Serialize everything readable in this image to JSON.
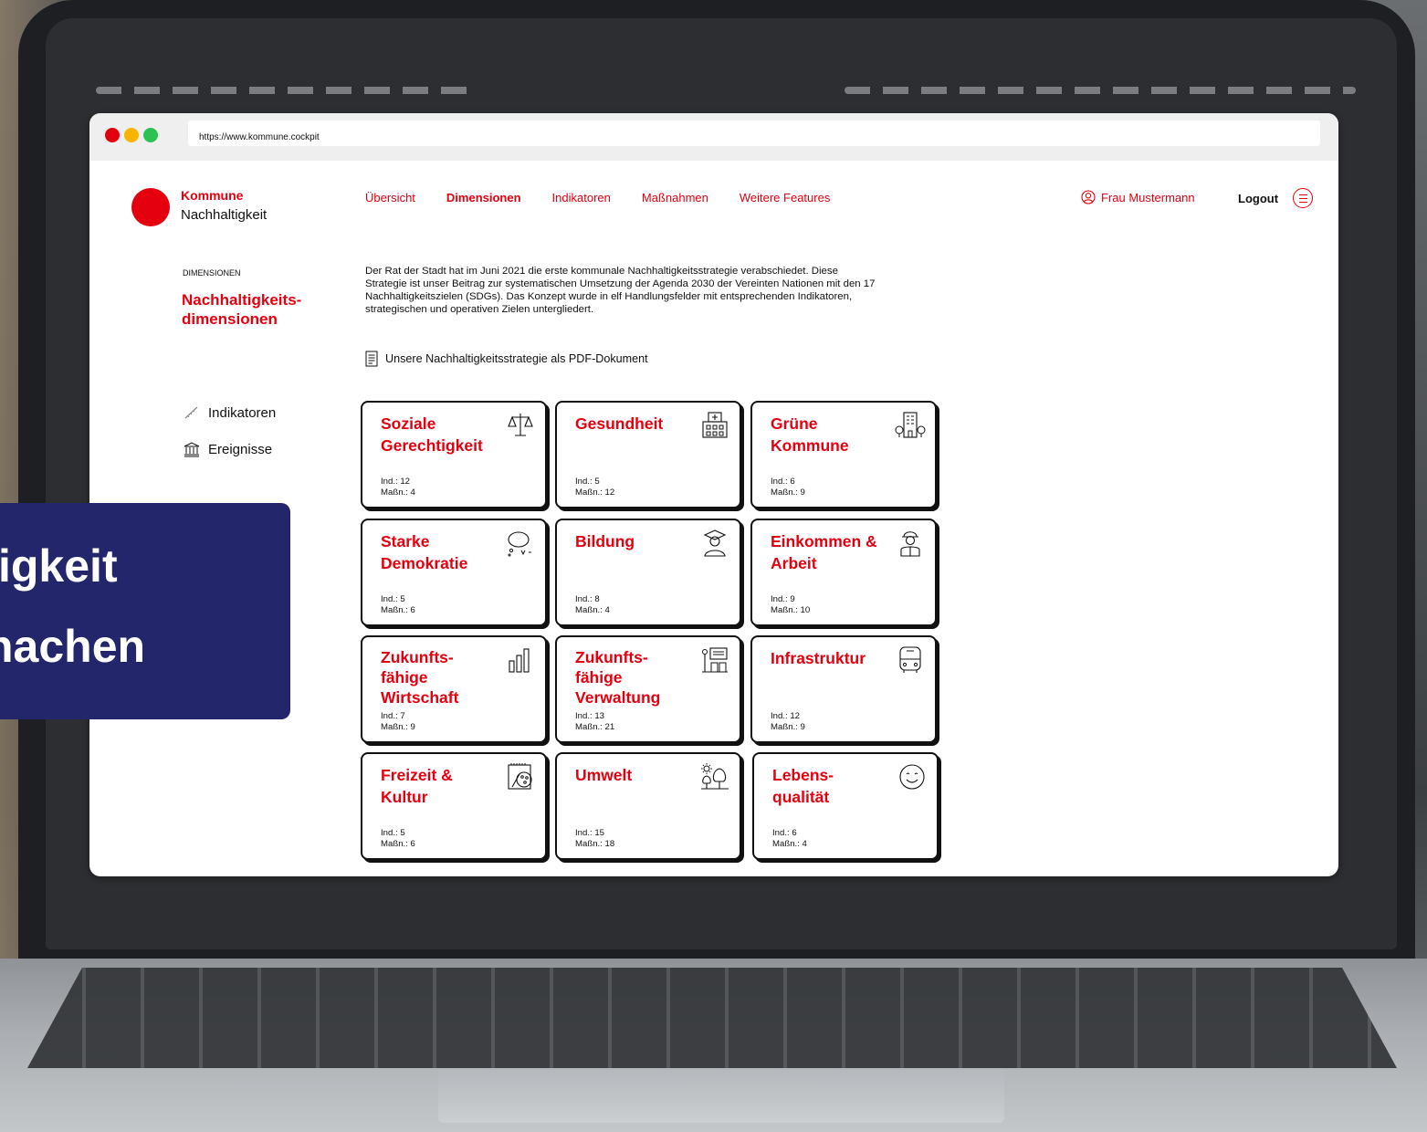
{
  "browser": {
    "url": "https://www.kommune.cockpit"
  },
  "brand": {
    "line1": "Kommune",
    "line2": "Nachhaltigkeit"
  },
  "nav": {
    "items": [
      {
        "label": "Übersicht",
        "active": false
      },
      {
        "label": "Dimensionen",
        "active": true
      },
      {
        "label": "Indikatoren",
        "active": false
      },
      {
        "label": "Maßnahmen",
        "active": false
      },
      {
        "label": "Weitere Features",
        "active": false
      }
    ]
  },
  "user": {
    "name": "Frau Mustermann",
    "logout_label": "Logout"
  },
  "sidebar": {
    "section_label": "DIMENSIONEN",
    "title": "Nachhaltigkeits-dimensionen",
    "links": [
      {
        "label": "Indikatoren",
        "icon": "ruler-icon"
      },
      {
        "label": "Ereignisse",
        "icon": "museum-icon"
      }
    ]
  },
  "intro": {
    "text": "Der Rat der Stadt hat im Juni 2021 die erste kommunale Nachhaltigkeitsstrategie verabschiedet. Diese Strategie ist unser Beitrag zur systematischen Umsetzung der Agenda 2030 der Vereinten Nationen mit den 17 Nachhaltigkeitszielen (SDGs). Das Konzept wurde in elf Handlungsfelder mit entsprechenden Indikatoren, strategischen und operativen Zielen untergliedert.",
    "pdf_link": "Unsere Nachhaltigkeitsstrategie als PDF-Dokument"
  },
  "cards": [
    {
      "title": "Soziale Gerechtigkeit",
      "ind": "Ind.: 12",
      "mass": "Maßn.: 4",
      "icon": "scales-icon"
    },
    {
      "title": "Gesundheit",
      "ind": "Ind.: 5",
      "mass": "Maßn.: 12",
      "icon": "hospital-icon"
    },
    {
      "title": "Grüne Kommune",
      "ind": "Ind.: 6",
      "mass": "Maßn.: 9",
      "icon": "green-building-icon"
    },
    {
      "title": "Starke Demokratie",
      "ind": "Ind.: 5",
      "mass": "Maßn.: 6",
      "icon": "speech-bubbles-icon"
    },
    {
      "title": "Bildung",
      "ind": "Ind.: 8",
      "mass": "Maßn.: 4",
      "icon": "graduate-icon"
    },
    {
      "title": "Einkommen & Arbeit",
      "ind": "Ind.: 9",
      "mass": "Maßn.: 10",
      "icon": "worker-icon"
    },
    {
      "title": "Zukunfts-fähige Wirtschaft",
      "ind": "Ind.: 7",
      "mass": "Maßn.: 9",
      "icon": "bar-chart-icon"
    },
    {
      "title": "Zukunfts-fähige Verwaltung",
      "ind": "Ind.: 13",
      "mass": "Maßn.: 21",
      "icon": "office-desk-icon"
    },
    {
      "title": "Infrastruktur",
      "ind": "Ind.: 12",
      "mass": "Maßn.: 9",
      "icon": "bus-icon"
    },
    {
      "title": "Freizeit & Kultur",
      "ind": "Ind.: 5",
      "mass": "Maßn.: 6",
      "icon": "palette-icon"
    },
    {
      "title": "Umwelt",
      "ind": "Ind.: 15",
      "mass": "Maßn.: 18",
      "icon": "tree-sun-icon"
    },
    {
      "title": "Lebens-qualität",
      "ind": "Ind.: 6",
      "mass": "Maßn.: 4",
      "icon": "smiley-icon"
    }
  ],
  "banner": {
    "line1": "igkeit",
    "line2": "nachen"
  },
  "colors": {
    "accent": "#e4000f",
    "banner": "#24266b",
    "text": "#111111"
  }
}
